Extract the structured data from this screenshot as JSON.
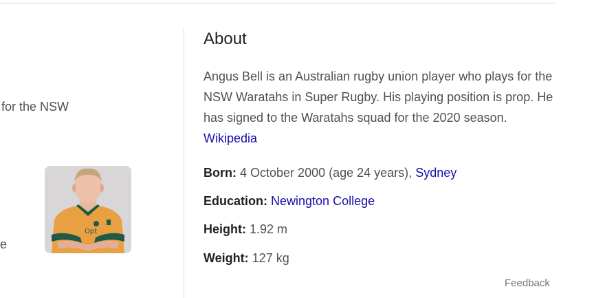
{
  "left_panel": {
    "snippet_1": "for the NSW",
    "snippet_2": "e"
  },
  "about": {
    "title": "About",
    "description": "Angus Bell is an Australian rugby union player who plays for the NSW Waratahs in Super Rugby. His playing position is prop. He has signed to the Waratahs squad for the 2020 season.",
    "source_link": "Wikipedia"
  },
  "facts": {
    "born": {
      "label": "Born:",
      "value": "4 October 2000 (age 24 years),",
      "link": "Sydney"
    },
    "education": {
      "label": "Education:",
      "link": "Newington College"
    },
    "height": {
      "label": "Height:",
      "value": "1.92 m"
    },
    "weight": {
      "label": "Weight:",
      "value": "127 kg"
    }
  },
  "feedback_label": "Feedback",
  "colors": {
    "link": "#1a0dab",
    "jersey": "#e9a042",
    "jersey_trim": "#1f5a45"
  }
}
